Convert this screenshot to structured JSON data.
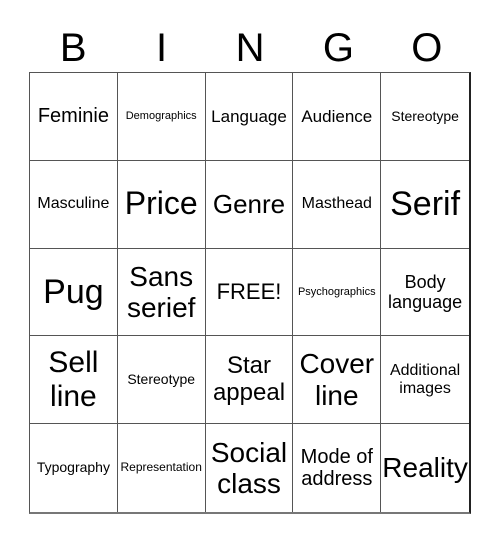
{
  "header": {
    "letters": [
      "B",
      "I",
      "N",
      "G",
      "O"
    ]
  },
  "card": {
    "cells": [
      "Feminie",
      "Demographics",
      "Language",
      "Audience",
      "Stereotype",
      "Masculine",
      "Price",
      "Genre",
      "Masthead",
      "Serif",
      "Pug",
      "Sans serief",
      "FREE!",
      "Psychographics",
      "Body language",
      "Sell line",
      "Stereotype",
      "Star appeal",
      "Cover line",
      "Additional images",
      "Typography",
      "Representation",
      "Social class",
      "Mode of address",
      "Reality"
    ],
    "free_space": "FREE!"
  }
}
